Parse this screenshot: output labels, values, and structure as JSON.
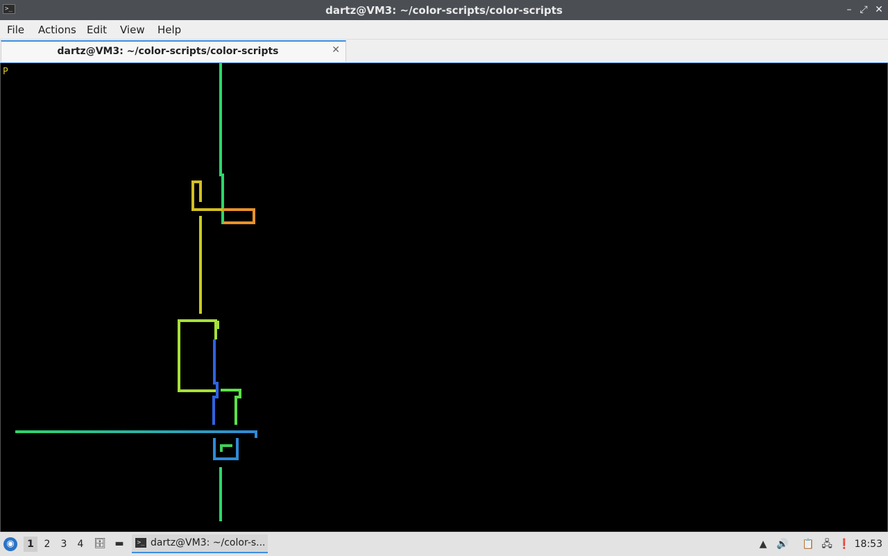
{
  "window": {
    "title": "dartz@VM3: ~/color-scripts/color-scripts",
    "minimize_icon": "minimize-icon",
    "maximize_icon": "maximize-icon",
    "close_icon": "close-icon"
  },
  "menu": {
    "items": [
      "File",
      "Actions",
      "Edit",
      "View",
      "Help"
    ]
  },
  "tabs": [
    {
      "label": "dartz@VM3: ~/color-scripts/color-scripts",
      "active": true
    }
  ],
  "terminal": {
    "prompt": "P",
    "background": "#000000",
    "pipe_colors": [
      "#2bd86a",
      "#d4c021",
      "#e8922a",
      "#a7e03a",
      "#2f63e0",
      "#5be04a",
      "#2f8ad8"
    ]
  },
  "taskbar": {
    "desktops": [
      "1",
      "2",
      "3",
      "4"
    ],
    "active_desktop": "1",
    "task_label": "dartz@VM3: ~/color-s...",
    "clock": "18:53"
  }
}
